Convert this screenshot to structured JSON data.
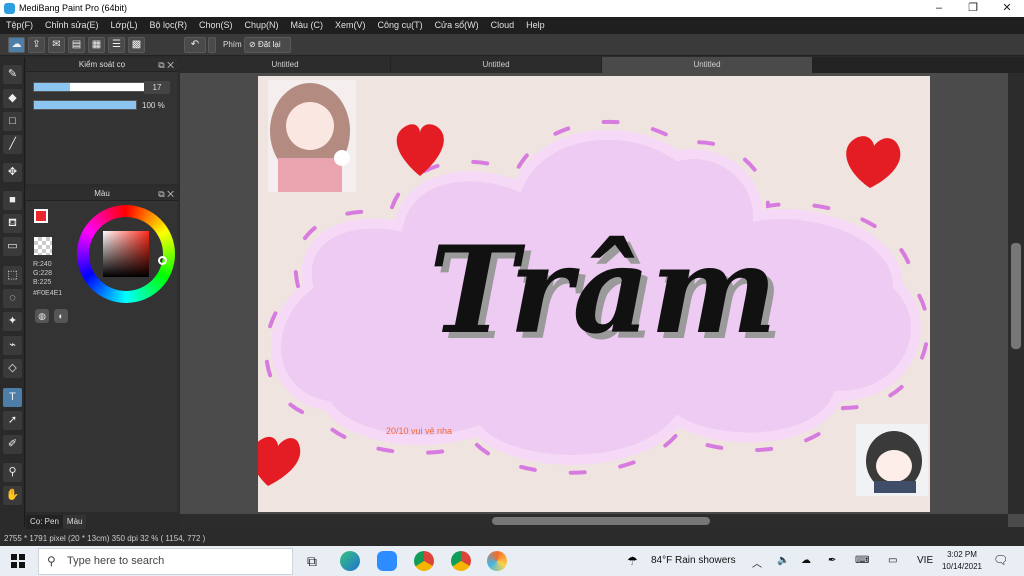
{
  "window": {
    "title": "MediBang Paint Pro (64bit)"
  },
  "menu": [
    "Tệp(F)",
    "Chỉnh sửa(E)",
    "Lớp(L)",
    "Bộ lọc(R)",
    "Chọn(S)",
    "Chụp(N)",
    "Màu (C)",
    "Xem(V)",
    "Công cụ(T)",
    "Cửa sổ(W)",
    "Cloud",
    "Help"
  ],
  "toolbar": {
    "key_label": "Phím",
    "reset_label": "Đặt lại"
  },
  "brush_panel": {
    "title": "Kiểm soát cọ",
    "size_value": "17",
    "opacity_value": "100 %",
    "size_fraction": 0.28,
    "opacity_fraction": 1.0
  },
  "color_panel": {
    "title": "Màu",
    "r": "R:240",
    "g": "G:228",
    "b": "B:225",
    "hex": "#F0E4E1",
    "primary_color": "#e8262b"
  },
  "doc_tabs": [
    "Untitled",
    "Untitled",
    "Untitled"
  ],
  "artwork": {
    "title_text": "Trâm",
    "subtitle_text": "20/10 vui vẻ nha",
    "bg_color": "#f0e4e1",
    "cloud_color": "#eecbf2",
    "dash_color": "#d77be0",
    "heart_color": "#e41c23"
  },
  "bottom_tabs": [
    "Cọ: Pen",
    "Màu"
  ],
  "status": {
    "text": "2755 * 1791 pixel  (20 * 13cm)  350 dpi  32 %  ( 1154, 772 )"
  },
  "taskbar": {
    "search_placeholder": "Type here to search",
    "weather": "84°F  Rain showers",
    "lang": "VIE",
    "time": "3:02 PM",
    "date": "10/14/2021"
  }
}
